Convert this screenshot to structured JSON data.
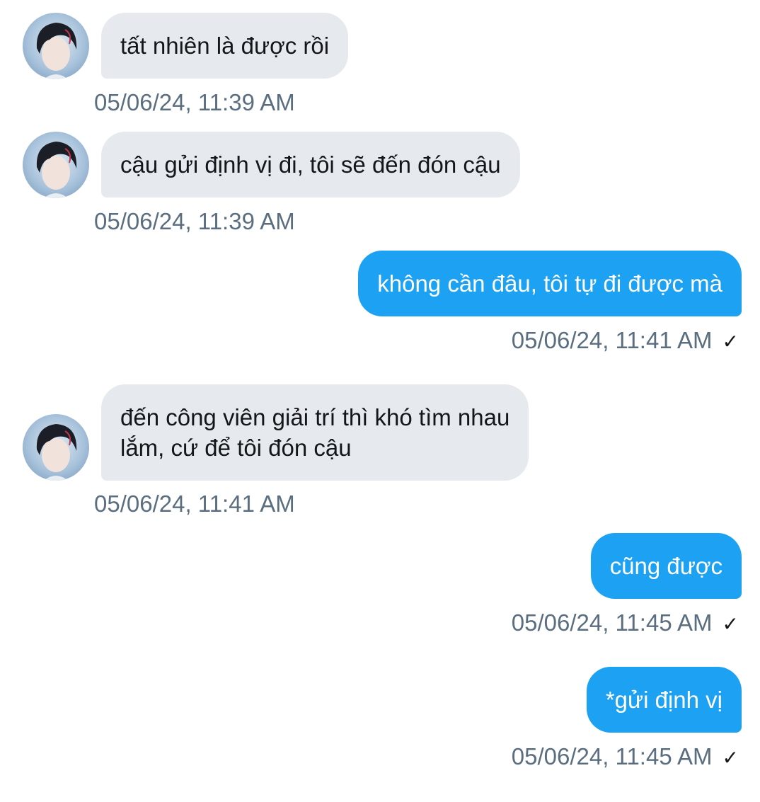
{
  "messages": [
    {
      "side": "in",
      "text": "tất nhiên là được rồi",
      "time": "05/06/24, 11:39 AM"
    },
    {
      "side": "in",
      "text": "cậu gửi định vị đi, tôi sẽ đến đón cậu",
      "time": "05/06/24, 11:39 AM"
    },
    {
      "side": "out",
      "text": "không cần đâu, tôi tự đi được mà",
      "time": "05/06/24, 11:41 AM",
      "status": "✓"
    },
    {
      "side": "in",
      "text": "đến công viên giải trí thì khó tìm nhau\nlắm, cứ để tôi đón cậu",
      "time": "05/06/24, 11:41 AM"
    },
    {
      "side": "out",
      "text": "cũng được",
      "time": "05/06/24, 11:45 AM",
      "status": "✓"
    },
    {
      "side": "out",
      "text": "*gửi định vị",
      "time": "05/06/24, 11:45 AM",
      "status": "✓"
    }
  ],
  "contact": {
    "avatar_icon": "profile-photo-avatar"
  },
  "colors": {
    "incoming_bubble": "#e6e9ed",
    "outgoing_bubble": "#1da1f2",
    "timestamp": "#5b6e80"
  }
}
